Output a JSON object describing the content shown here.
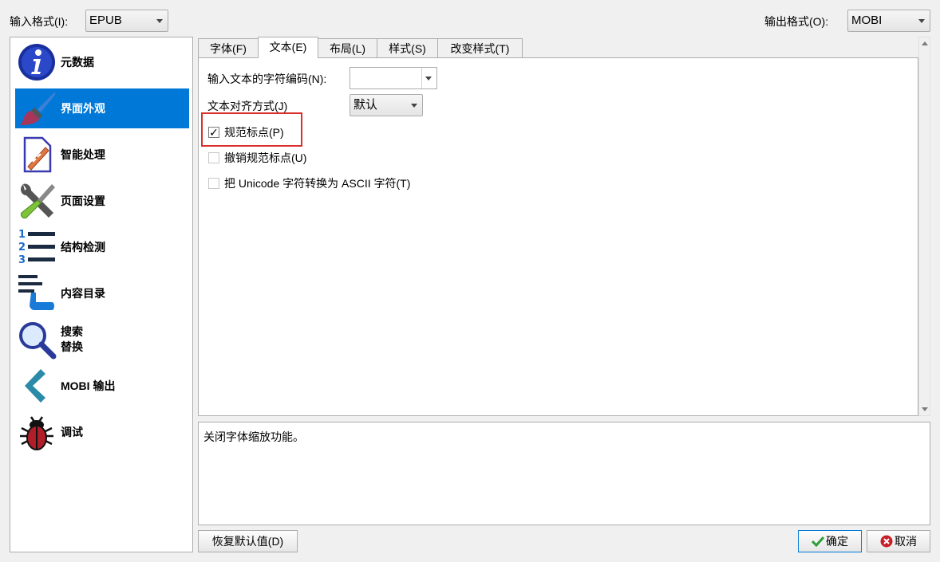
{
  "top": {
    "input_format_label": "输入格式(I):",
    "input_format_value": "EPUB",
    "output_format_label": "输出格式(O):",
    "output_format_value": "MOBI"
  },
  "sidebar": {
    "items": [
      {
        "label": "元数据",
        "icon": "info-icon"
      },
      {
        "label": "界面外观",
        "icon": "paintbrush-icon"
      },
      {
        "label": "智能处理",
        "icon": "document-magic-icon"
      },
      {
        "label": "页面设置",
        "icon": "tools-icon"
      },
      {
        "label": "结构检测",
        "icon": "numbered-list-icon"
      },
      {
        "label": "内容目录",
        "icon": "toc-pointer-icon"
      },
      {
        "label": "搜索",
        "label2": "替换",
        "icon": "magnifier-icon"
      },
      {
        "label": "MOBI 输出",
        "icon": "chevron-left-icon"
      },
      {
        "label": "调试",
        "icon": "bug-icon"
      }
    ],
    "selected": "界面外观"
  },
  "tabs": [
    {
      "label": "字体(F)"
    },
    {
      "label": "文本(E)",
      "active": true
    },
    {
      "label": "布局(L)"
    },
    {
      "label": "样式(S)"
    },
    {
      "label": "改变样式(T)"
    }
  ],
  "panel": {
    "encoding_label": "输入文本的字符编码(N):",
    "encoding_value": "",
    "align_label": "文本对齐方式(J)",
    "align_value": "默认",
    "smarten_label": "规范标点(P)",
    "smarten_checked": true,
    "unsmarten_label": "撤销规范标点(U)",
    "unsmarten_checked": false,
    "ascii_label": "把 Unicode 字符转换为 ASCII 字符(T)",
    "ascii_checked": false,
    "check_mark": "✓"
  },
  "description": "关闭字体缩放功能。",
  "buttons": {
    "restore": "恢复默认值(D)",
    "ok": "确定",
    "cancel": "取消"
  },
  "colors": {
    "selection": "#0078d7",
    "highlight": "#d9302c",
    "ok_icon": "#2e9e3a",
    "cancel_icon": "#c8202a"
  }
}
